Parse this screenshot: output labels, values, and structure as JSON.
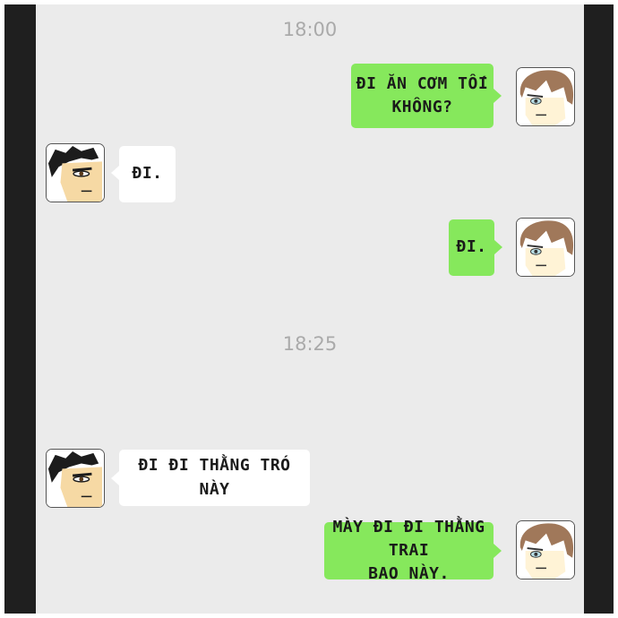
{
  "timestamps": [
    "18:00",
    "18:25"
  ],
  "messages": [
    {
      "side": "right",
      "avatar": "brown-hair-character-avatar",
      "text_lines": [
        "ĐI ĂN CƠM TỐI",
        "KHÔNG?"
      ]
    },
    {
      "side": "left",
      "avatar": "black-hair-character-avatar",
      "text_lines": [
        "ĐI."
      ]
    },
    {
      "side": "right",
      "avatar": "brown-hair-character-avatar",
      "text_lines": [
        "ĐI."
      ]
    },
    {
      "side": "left",
      "avatar": "black-hair-character-avatar",
      "text_lines": [
        "ĐI ĐI THẰNG TRÓ NÀY"
      ]
    },
    {
      "side": "right",
      "avatar": "brown-hair-character-avatar",
      "text_lines": [
        "MÀY ĐI ĐI THẰNG TRAI",
        "BAO NÀY."
      ]
    }
  ],
  "colors": {
    "frame": "#1f1f1f",
    "chat_background": "#ebebeb",
    "sent_bubble": "#86e85c",
    "received_bubble": "#ffffff",
    "timestamp_text": "#aaaaaa"
  }
}
